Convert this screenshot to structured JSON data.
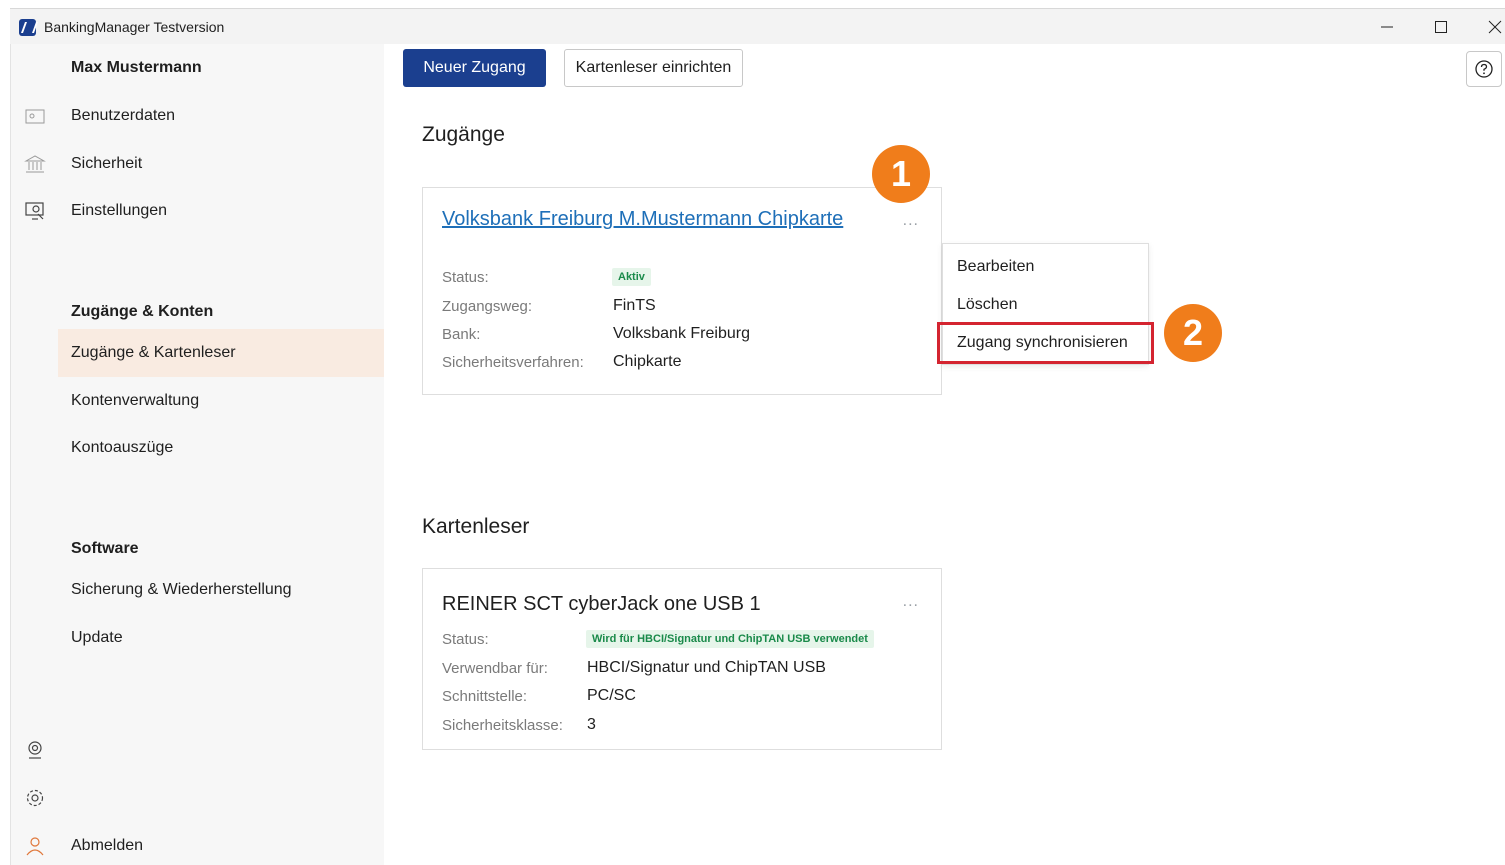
{
  "window": {
    "title": "BankingManager Testversion",
    "minimize_icon": "minimize-icon",
    "maximize_icon": "maximize-icon",
    "close_icon": "close-icon"
  },
  "sidebar": {
    "user_name": "Max Mustermann",
    "items_top": [
      {
        "label": "Benutzerdaten",
        "icon": "id-card-icon"
      },
      {
        "label": "Sicherheit",
        "icon": "bank-icon"
      },
      {
        "label": "Einstellungen",
        "icon": "settings-screen-icon"
      }
    ],
    "section_accounts": "Zugänge & Konten",
    "items_accounts": [
      {
        "label": "Zugänge & Kartenleser",
        "active": true
      },
      {
        "label": "Kontenverwaltung"
      },
      {
        "label": "Kontoauszüge"
      }
    ],
    "section_software": "Software",
    "items_software": [
      {
        "label": "Sicherung & Wiederherstellung"
      },
      {
        "label": "Update"
      }
    ],
    "logout": "Abmelden"
  },
  "toolbar": {
    "new_access_label": "Neuer Zugang",
    "setup_reader_label": "Kartenleser einrichten",
    "help_icon": "help-icon"
  },
  "access_section": {
    "title": "Zugänge",
    "card": {
      "name": "Volksbank Freiburg M.Mustermann Chipkarte",
      "more": "...",
      "fields": [
        {
          "label": "Status:",
          "value": "Aktiv",
          "badge": true
        },
        {
          "label": "Zugangsweg:",
          "value": "FinTS"
        },
        {
          "label": "Bank:",
          "value": "Volksbank Freiburg"
        },
        {
          "label": "Sicherheitsverfahren:",
          "value": "Chipkarte"
        }
      ]
    },
    "menu": {
      "items": [
        "Bearbeiten",
        "Löschen",
        "Zugang synchronisieren"
      ],
      "highlighted_index": 2
    }
  },
  "reader_section": {
    "title": "Kartenleser",
    "card": {
      "name": "REINER SCT cyberJack one USB 1",
      "more": "...",
      "fields": [
        {
          "label": "Status:",
          "value": "Wird für HBCI/Signatur und ChipTAN USB verwendet",
          "badge": true
        },
        {
          "label": "Verwendbar für:",
          "value": "HBCI/Signatur und ChipTAN USB"
        },
        {
          "label": "Schnittstelle:",
          "value": "PC/SC"
        },
        {
          "label": "Sicherheitsklasse:",
          "value": "3"
        }
      ]
    }
  },
  "annotations": {
    "marker_1": "1",
    "marker_2": "2",
    "marker_color": "#f07d1b",
    "highlight_color": "#d42430"
  },
  "colors": {
    "primary": "#1b3f8f",
    "link": "#1e6fb8",
    "active_bg": "#f9ebe1",
    "success": "#1a8a4a"
  }
}
